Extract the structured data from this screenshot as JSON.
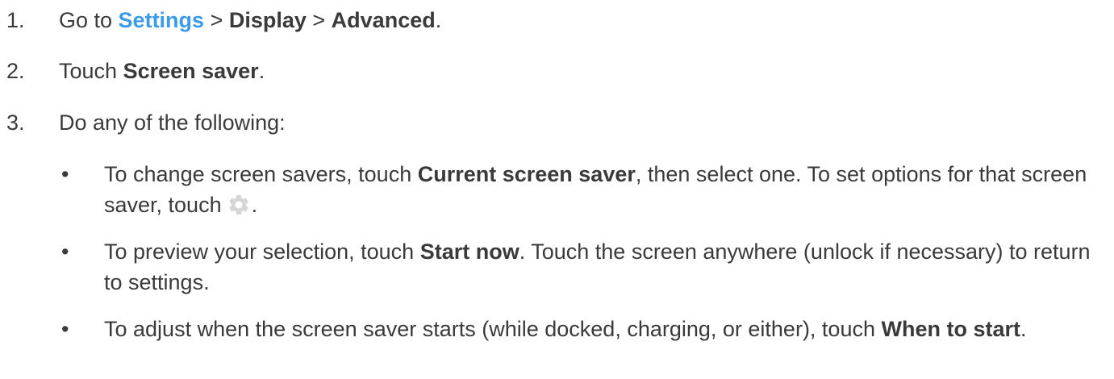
{
  "steps": [
    {
      "number": "1.",
      "prefix": "Go to ",
      "settings_link": "Settings",
      "sep1": " > ",
      "display": "Display",
      "sep2": " > ",
      "advanced": "Advanced",
      "suffix": "."
    },
    {
      "number": "2.",
      "prefix": "Touch ",
      "screen_saver": "Screen saver",
      "suffix": "."
    },
    {
      "number": "3.",
      "text": "Do any of the following:"
    }
  ],
  "bullets": [
    {
      "dot": "•",
      "part1": "To change screen savers, touch ",
      "bold1": "Current screen saver",
      "part2": ", then select one. To set options for that screen saver, touch",
      "icon": "gear-icon",
      "part3": "."
    },
    {
      "dot": "•",
      "part1": "To preview your selection, touch ",
      "bold1": "Start now",
      "part2": ". Touch the screen anywhere (unlock if necessary) to return to settings."
    },
    {
      "dot": "•",
      "part1": "To adjust when the screen saver starts (while docked, charging, or either), touch ",
      "bold1": "When to start",
      "part2": "."
    }
  ],
  "colors": {
    "text": "#3a3a3a",
    "link": "#3d9ae8",
    "icon": "#d6d6d6"
  }
}
